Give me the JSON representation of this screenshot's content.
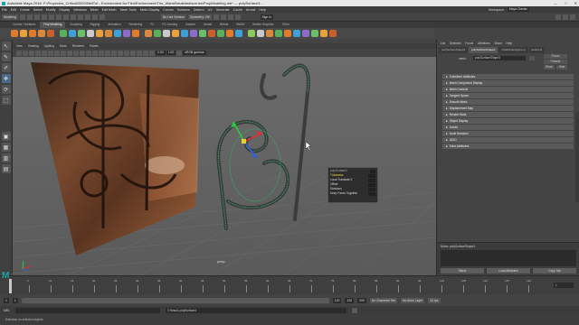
{
  "titlebar": {
    "title": "Autodesk Maya 2018: F:\\Proyectos_Critical\\2020\\NeilTut - Environment for Film\\Environment\\The_WarmBreakfast\\scenes\\PropModeling.mb* --- polySurface3...",
    "minimize": "—",
    "maximize": "□",
    "close": "✕"
  },
  "menubar": {
    "items": [
      "File",
      "Edit",
      "Create",
      "Select",
      "Modify",
      "Display",
      "Windows",
      "Mesh",
      "Edit Mesh",
      "Mesh Tools",
      "Mesh Display",
      "Curves",
      "Surfaces",
      "Deform",
      "UV",
      "Generate",
      "Cache",
      "Arnold",
      "Help"
    ],
    "workspace_label": "Workspace:",
    "workspace_value": "Maya Classic"
  },
  "statusline": {
    "mode": "Modeling",
    "no_live_surface": "No Live Surface",
    "symmetry": "Symmetry: Off",
    "sign_in": "Sign In"
  },
  "shelf": {
    "tabs": [
      "Curves / Surfaces",
      "Poly Modeling",
      "Sculpting",
      "Rigging",
      "Animation",
      "Rendering",
      "FX",
      "FX Caching",
      "Custom",
      "Arnold",
      "Bifrost",
      "MASH",
      "Motion Graphics",
      "XGen"
    ],
    "active_tab": "Poly Modeling",
    "icon_colors": [
      "#e07b2b",
      "#e9a13b",
      "#e07b2b",
      "#d9893a",
      "#c95f2a",
      "#5ab05a",
      "#3fa0d8",
      "#6bbf6b",
      "#c9c9c9",
      "#e9a13b",
      "#d9893a",
      "#3fa0d8",
      "#8c6cc9",
      "#e07b2b",
      "#d9893a",
      "#5ab05a",
      "#c9c9c9",
      "#e9a13b",
      "#3fa0d8",
      "#8c6cc9",
      "#6bbf6b",
      "#c95f2a",
      "#5ab05a",
      "#e07b2b",
      "#3fa0d8",
      "#8cc95a",
      "#c9c9c9",
      "#d9893a",
      "#5ab05a",
      "#e07b2b",
      "#3fa0d8",
      "#8c6cc9",
      "#6bbf6b",
      "#e9a13b",
      "#c95f2a"
    ]
  },
  "toolbox": {
    "tools": [
      {
        "name": "select-tool-icon",
        "glyph": "↖"
      },
      {
        "name": "lasso-tool-icon",
        "glyph": "✎"
      },
      {
        "name": "paint-select-icon",
        "glyph": "✐"
      },
      {
        "name": "move-tool-icon",
        "glyph": "✥"
      },
      {
        "name": "rotate-tool-icon",
        "glyph": "⟳"
      },
      {
        "name": "scale-tool-icon",
        "glyph": "⬚"
      },
      {
        "name": "layout-single-icon",
        "glyph": "▣"
      },
      {
        "name": "layout-four-icon",
        "glyph": "▦"
      },
      {
        "name": "layout-two-icon",
        "glyph": "▥"
      },
      {
        "name": "layout-outliner-icon",
        "glyph": "▤"
      }
    ]
  },
  "viewport": {
    "menu": [
      "View",
      "Shading",
      "Lighting",
      "Show",
      "Renderer",
      "Panels"
    ],
    "camera_field": "0.00",
    "scale_field": "1.00",
    "color_space": "sRGB gamma",
    "camera_label": "persp",
    "axis_x": "X",
    "axis_y": "Y",
    "axis_z": "Z"
  },
  "marking_menu": {
    "title": "polySurface3",
    "rows": [
      {
        "label": "Thickness",
        "highlight": true
      },
      {
        "label": "Local Translate Z",
        "highlight": false
      },
      {
        "label": "Offset",
        "highlight": false
      },
      {
        "label": "Divisions",
        "highlight": false
      },
      {
        "label": "Keep Faces Together",
        "highlight": false
      }
    ]
  },
  "attribute_editor": {
    "menu": [
      "List",
      "Selected",
      "Focus",
      "Attributes",
      "Show",
      "Help"
    ],
    "tabs": [
      "polySurfaceShape3",
      "polySurfaceShape3",
      "initialShadingGroup",
      "lambert1"
    ],
    "active_tab": 1,
    "field_label": "mesh:",
    "field_value": "polySurfaceShape3",
    "focus_btn": "Focus",
    "presets_btn": "Presets",
    "show_btn": "Show",
    "hide_btn": "Hide",
    "sections": [
      "Transform Attributes",
      "Mesh Component Display",
      "Mesh Controls",
      "Tangent Space",
      "Smooth Mesh",
      "Displacement Map",
      "Render Stats",
      "Object Display",
      "Arnold",
      "Node Behavior",
      "UUID",
      "Extra Attributes"
    ],
    "notes_label": "Notes: polySurfaceShape3",
    "buttons": [
      "Select",
      "Load Attributes",
      "Copy Tab"
    ]
  },
  "timeslider": {
    "ticks": [
      "5",
      "10",
      "15",
      "20",
      "25",
      "30",
      "35",
      "40",
      "45",
      "50",
      "55",
      "60",
      "65",
      "70",
      "75",
      "80",
      "85",
      "90",
      "95",
      "100",
      "105",
      "110",
      "115",
      "120"
    ],
    "current_frame": "1"
  },
  "rangeslider": {
    "start": "1",
    "start_inner": "1",
    "range_end_inner": "120",
    "end_inner": "120",
    "end": "200",
    "char_set": "No Character Set",
    "anim_layer": "No Anim Layer",
    "fps": "24 fps"
  },
  "cmdline": {
    "lang": "MEL",
    "result": "// Result: polySurface3"
  },
  "helpline": {
    "text": "Extrusion on selected objects"
  }
}
